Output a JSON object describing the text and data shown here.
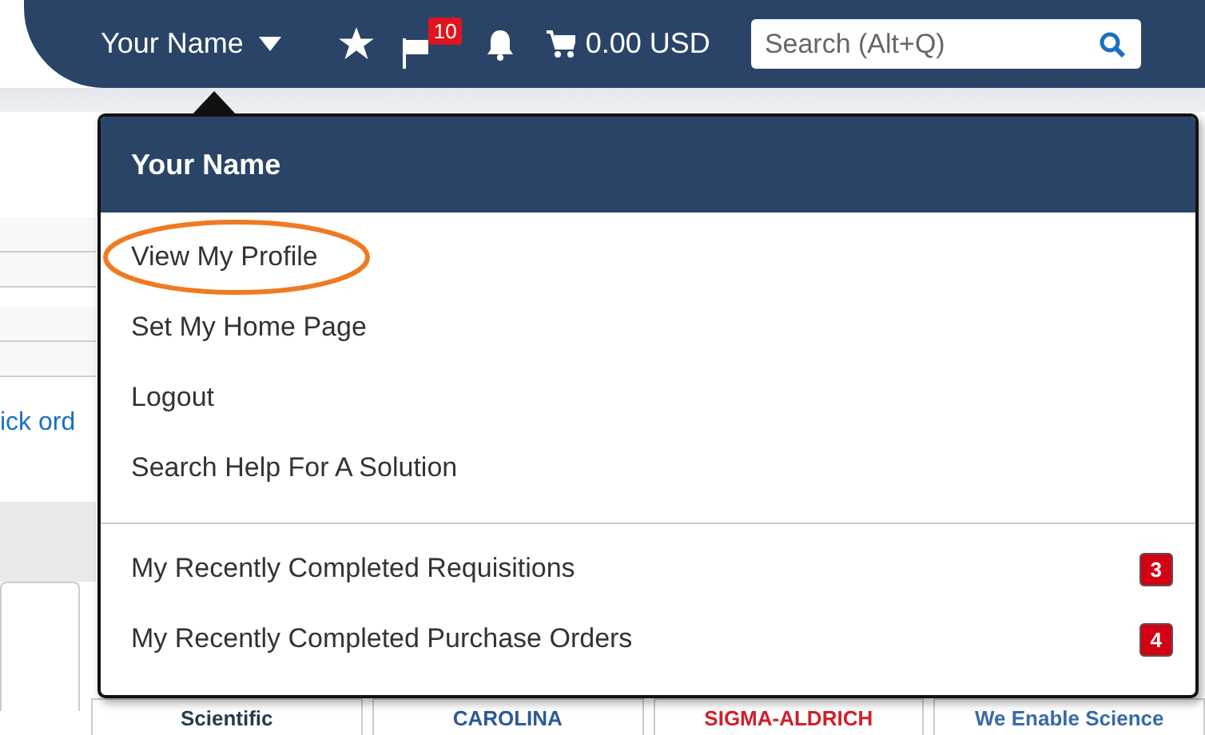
{
  "nav": {
    "user": "Your Name",
    "flag_count": "10",
    "cart_total": "0.00 USD",
    "search": {
      "placeholder": "Search (Alt+Q)"
    }
  },
  "background": {
    "link": "ick ord",
    "logos": [
      "Scientific",
      "CAROLINA",
      "SIGMA-ALDRICH",
      "We Enable Science"
    ]
  },
  "menu": {
    "title": "Your Name",
    "sections": [
      {
        "items": [
          {
            "label": "View My Profile",
            "circled": true
          },
          {
            "label": "Set My Home Page",
            "circled": false
          },
          {
            "label": "Logout",
            "circled": false
          },
          {
            "label": "Search Help For A Solution",
            "circled": false
          }
        ]
      },
      {
        "items": [
          {
            "label": "My Recently Completed Requisitions",
            "count": "3",
            "circled": false
          },
          {
            "label": "My Recently Completed Purchase Orders",
            "count": "4",
            "circled": false
          }
        ]
      }
    ]
  }
}
